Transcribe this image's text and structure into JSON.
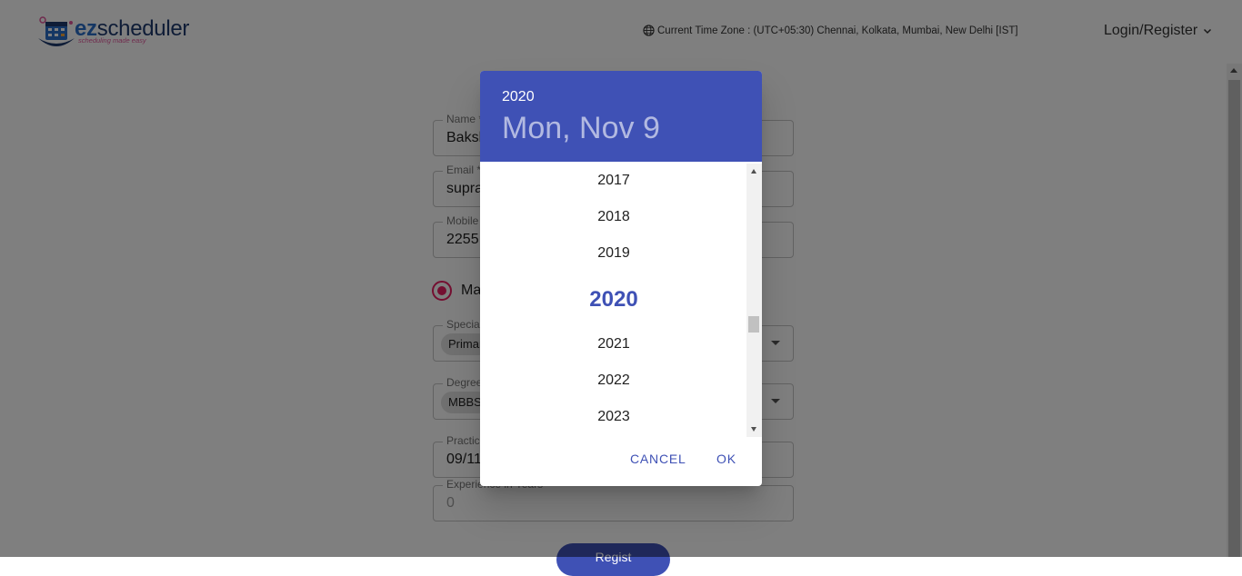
{
  "header": {
    "logo_text_prefix": "ez",
    "logo_text_suffix": "scheduler",
    "logo_tagline": "scheduling made easy",
    "timezone_text": "Current Time Zone : (UTC+05:30) Chennai, Kolkata, Mumbai, New Delhi [IST]",
    "login_label": "Login/Register"
  },
  "form": {
    "name": {
      "label": "Name *",
      "value": "Baksh"
    },
    "email": {
      "label": "Email *",
      "value": "supra"
    },
    "mobile": {
      "label": "Mobile",
      "value": "2255"
    },
    "gender_label": "Ma",
    "speciality": {
      "label": "Special",
      "chip": "Primar"
    },
    "degree": {
      "label": "Degree",
      "chip": "MBBS"
    },
    "practice": {
      "label": "Practic",
      "value": "09/11"
    },
    "experience": {
      "label": "Experience in Years",
      "value": "0"
    },
    "register_label": "Regist"
  },
  "dialog": {
    "header_year": "2020",
    "header_date": "Mon, Nov 9",
    "years": [
      "2017",
      "2018",
      "2019",
      "2020",
      "2021",
      "2022",
      "2023"
    ],
    "selected_year": "2020",
    "cancel_label": "CANCEL",
    "ok_label": "OK"
  },
  "colors": {
    "primary": "#3f51b5",
    "radio_accent": "#e91e63"
  }
}
